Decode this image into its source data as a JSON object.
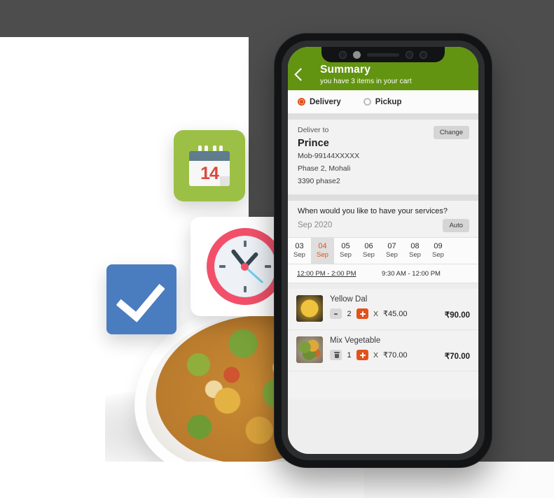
{
  "app": {
    "header": {
      "title": "Summary",
      "subtitle": "you have 3 items in your cart",
      "back_icon": "chevron-left-icon",
      "bg_color": "#629412"
    },
    "fulfillment": {
      "options": [
        {
          "label": "Delivery",
          "selected": true
        },
        {
          "label": "Pickup",
          "selected": false
        }
      ],
      "accent_color": "#e2521c"
    },
    "address": {
      "label": "Deliver to",
      "change_button": "Change",
      "name": "Prince",
      "lines": [
        "Mob-99144XXXXX",
        "Phase 2, Mohali",
        "3390 phase2"
      ]
    },
    "schedule": {
      "question": "When would you like to have your services?",
      "month": "Sep 2020",
      "auto_button": "Auto",
      "dates": [
        {
          "day": "03",
          "month": "Sep",
          "selected": false
        },
        {
          "day": "04",
          "month": "Sep",
          "selected": true
        },
        {
          "day": "05",
          "month": "Sep",
          "selected": false
        },
        {
          "day": "06",
          "month": "Sep",
          "selected": false
        },
        {
          "day": "07",
          "month": "Sep",
          "selected": false
        },
        {
          "day": "08",
          "month": "Sep",
          "selected": false
        },
        {
          "day": "09",
          "month": "Sep",
          "selected": false
        }
      ],
      "slots": [
        {
          "label": "12:00 PM - 2:00 PM",
          "selected": true
        },
        {
          "label": "9:30 AM - 12:00 PM",
          "selected": false
        }
      ]
    },
    "cart": {
      "items": [
        {
          "name": "Yellow Dal",
          "quantity": "2",
          "decrement_icon": "minus-icon",
          "increment_icon": "plus-icon",
          "multiply_sign": "X",
          "unit_price": "₹45.00",
          "line_total": "₹90.00",
          "thumbnail": "yellow-dal-thumbnail"
        },
        {
          "name": "Mix Vegetable",
          "quantity": "1",
          "decrement_icon": "trash-icon",
          "increment_icon": "plus-icon",
          "multiply_sign": "X",
          "unit_price": "₹70.00",
          "line_total": "₹70.00",
          "thumbnail": "mix-vegetable-thumbnail"
        }
      ]
    }
  },
  "decor": {
    "calendar_card": {
      "number": "14",
      "icon": "calendar-icon",
      "bg_color": "#9cc046"
    },
    "clock_card": {
      "icon": "clock-icon",
      "bg_color": "#ffffff",
      "ring_color": "#f2506a"
    },
    "check_card": {
      "icon": "check-icon",
      "bg_color": "#4a7cc0"
    },
    "food_photo": "mix-vegetable-bowl-photo"
  }
}
